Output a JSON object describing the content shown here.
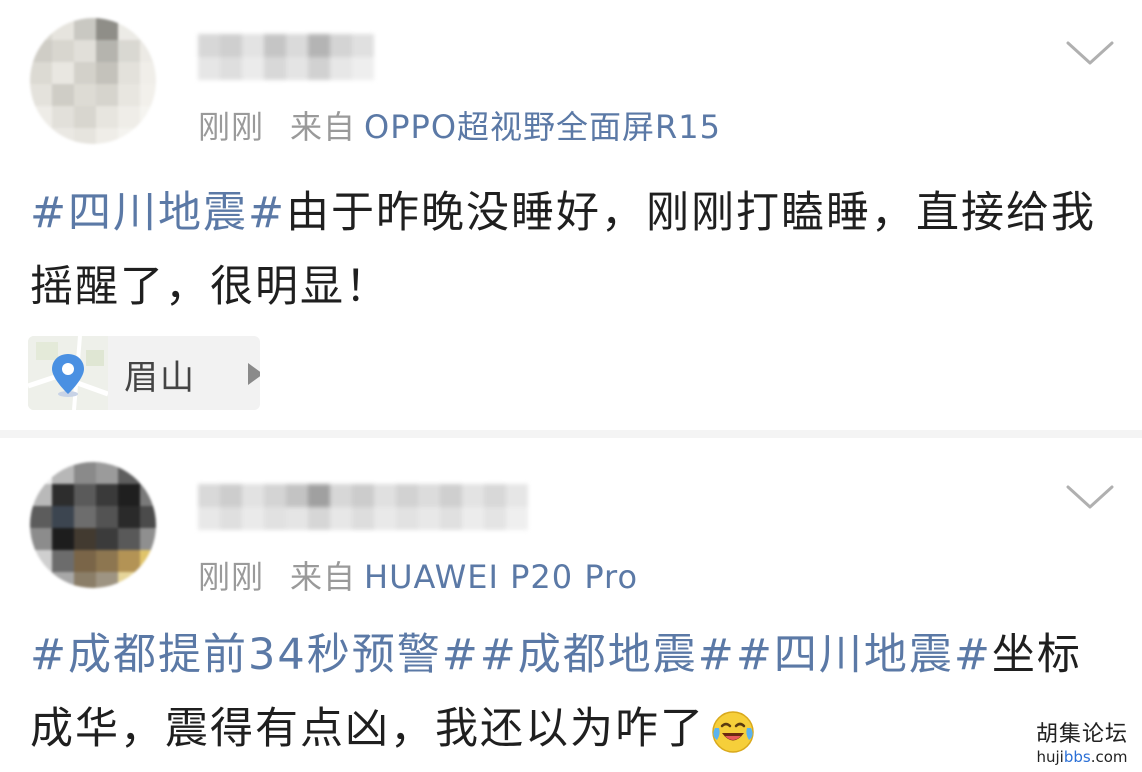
{
  "posts": [
    {
      "time": "刚刚",
      "source_prefix": "来自",
      "device": "OPPO超视野全面屏R15",
      "content_segments": [
        {
          "text": "#四川地震#",
          "tag": true
        },
        {
          "text": "由于昨晚没睡好，刚刚打瞌睡，直接给我摇醒了，很明显！",
          "tag": false
        }
      ],
      "location": "眉山",
      "icons": {
        "menu": "chevron-down-icon",
        "location": "map-pin-icon",
        "location_arrow": "play-arrow-icon"
      }
    },
    {
      "time": "刚刚",
      "source_prefix": "来自",
      "device": "HUAWEI P20 Pro",
      "content_segments": [
        {
          "text": "#成都提前34秒预警#",
          "tag": true
        },
        {
          "text": "#成都地震#",
          "tag": true
        },
        {
          "text": "#四川地震#",
          "tag": true
        },
        {
          "text": "坐标成华，震得有点凶，我还以为咋了",
          "tag": false
        }
      ],
      "emoji": "laughing-crying-emoji",
      "icons": {
        "menu": "chevron-down-icon"
      }
    }
  ],
  "watermark": {
    "title": "胡集论坛",
    "url_parts": [
      "huji",
      "bbs",
      ".com"
    ]
  },
  "colors": {
    "tag": "#5b79a6",
    "meta": "#9a9a9a",
    "text": "#1f1f1f"
  }
}
